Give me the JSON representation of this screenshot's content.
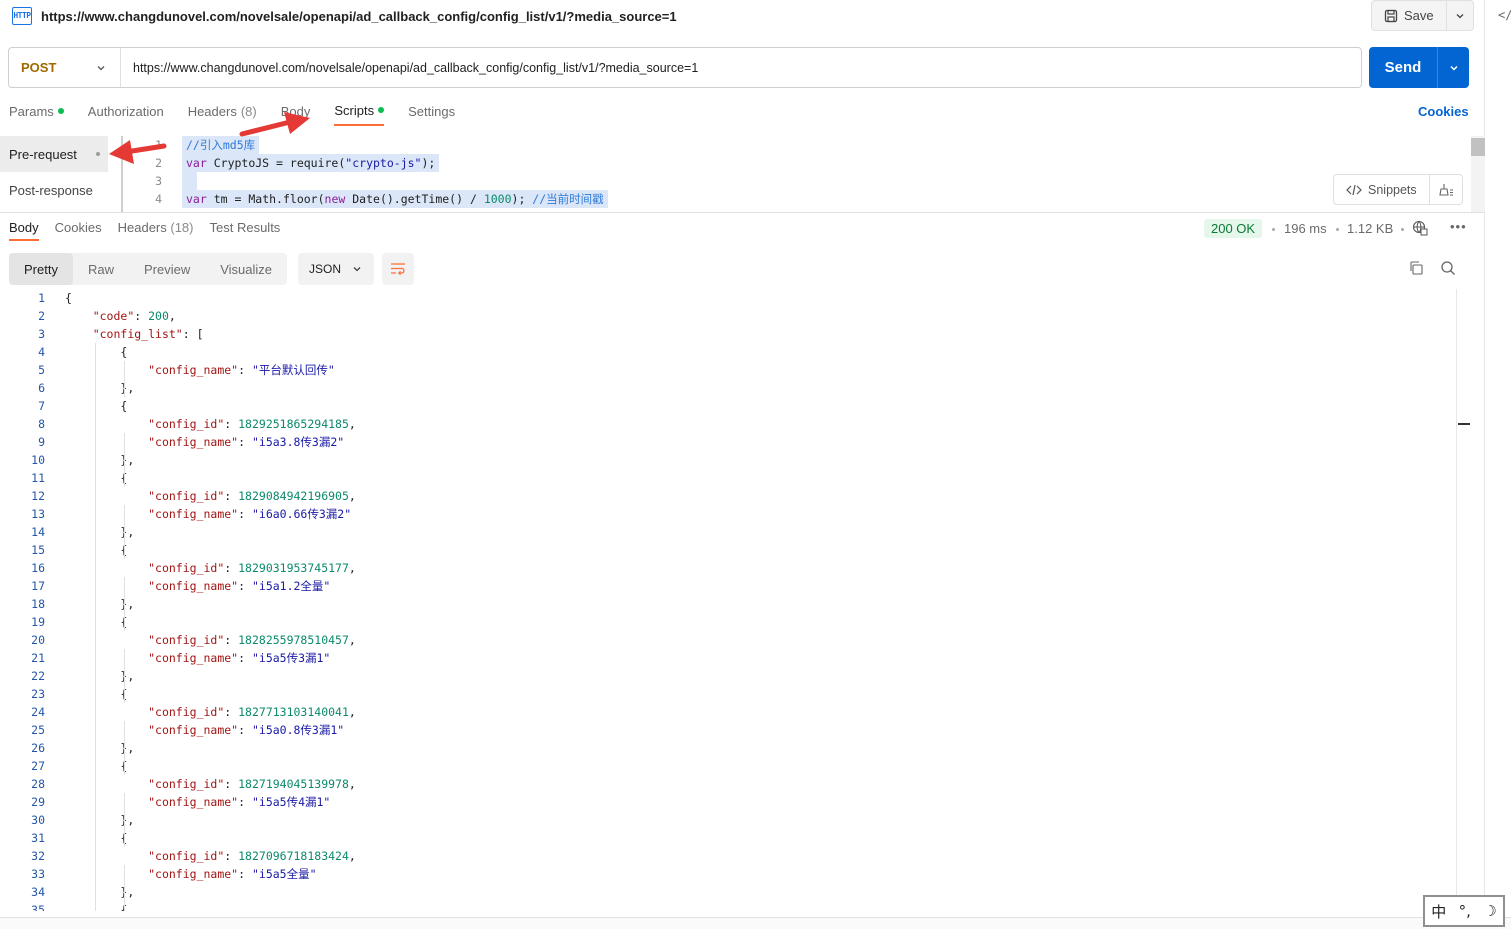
{
  "titlebar": {
    "badge": "HTTP",
    "title": "https://www.changdunovel.com/novelsale/openapi/ad_callback_config/config_list/v1/?media_source=1",
    "save_label": "Save"
  },
  "request": {
    "method": "POST",
    "url": "https://www.changdunovel.com/novelsale/openapi/ad_callback_config/config_list/v1/?media_source=1",
    "send_label": "Send",
    "cookies_label": "Cookies"
  },
  "req_tabs": {
    "params": "Params",
    "authorization": "Authorization",
    "headers": "Headers",
    "headers_count": "(8)",
    "body": "Body",
    "scripts": "Scripts",
    "settings": "Settings"
  },
  "script_side": {
    "pre_request": "Pre-request",
    "post_response": "Post-response"
  },
  "snippets_label": "Snippets",
  "script_lines": [
    {
      "n": "1",
      "comment": "//引入md5库"
    },
    {
      "n": "2",
      "kw": "var",
      "var": "CryptoJS",
      "fn": "require",
      "str": "\"crypto-js\""
    },
    {
      "n": "3"
    },
    {
      "n": "4",
      "kw": "var",
      "var": "tm",
      "expr1": "Math.floor(",
      "kw2": "new",
      "expr2": "Date().getTime()",
      "num": "1000",
      "comment": "//当前时间戳"
    }
  ],
  "res_tabs": {
    "body": "Body",
    "cookies": "Cookies",
    "headers": "Headers",
    "headers_count": "(18)",
    "test_results": "Test Results"
  },
  "response_meta": {
    "status": "200 OK",
    "time": "196 ms",
    "size": "1.12 KB"
  },
  "view_modes": {
    "pretty": "Pretty",
    "raw": "Raw",
    "preview": "Preview",
    "visualize": "Visualize",
    "format": "JSON"
  },
  "json_lines": [
    {
      "n": "1",
      "t": "{"
    },
    {
      "n": "2",
      "k": "\"code\"",
      "v": "200",
      "vt": "num",
      "tail": ",",
      "ind": 1
    },
    {
      "n": "3",
      "k": "\"config_list\"",
      "t2": ": [",
      "ind": 1
    },
    {
      "n": "4",
      "t": "{",
      "ind": 2
    },
    {
      "n": "5",
      "k": "\"config_name\"",
      "v": "\"平台默认回传\"",
      "vt": "str",
      "tail": "",
      "ind": 3
    },
    {
      "n": "6",
      "t": "},",
      "ind": 2
    },
    {
      "n": "7",
      "t": "{",
      "ind": 2
    },
    {
      "n": "8",
      "k": "\"config_id\"",
      "v": "1829251865294185",
      "vt": "num",
      "tail": ",",
      "ind": 3
    },
    {
      "n": "9",
      "k": "\"config_name\"",
      "v": "\"i5a3.8传3漏2\"",
      "vt": "str",
      "tail": "",
      "ind": 3
    },
    {
      "n": "10",
      "t": "},",
      "ind": 2
    },
    {
      "n": "11",
      "t": "{",
      "ind": 2
    },
    {
      "n": "12",
      "k": "\"config_id\"",
      "v": "1829084942196905",
      "vt": "num",
      "tail": ",",
      "ind": 3
    },
    {
      "n": "13",
      "k": "\"config_name\"",
      "v": "\"i6a0.66传3漏2\"",
      "vt": "str",
      "tail": "",
      "ind": 3
    },
    {
      "n": "14",
      "t": "},",
      "ind": 2
    },
    {
      "n": "15",
      "t": "{",
      "ind": 2
    },
    {
      "n": "16",
      "k": "\"config_id\"",
      "v": "1829031953745177",
      "vt": "num",
      "tail": ",",
      "ind": 3
    },
    {
      "n": "17",
      "k": "\"config_name\"",
      "v": "\"i5a1.2全量\"",
      "vt": "str",
      "tail": "",
      "ind": 3
    },
    {
      "n": "18",
      "t": "},",
      "ind": 2
    },
    {
      "n": "19",
      "t": "{",
      "ind": 2
    },
    {
      "n": "20",
      "k": "\"config_id\"",
      "v": "1828255978510457",
      "vt": "num",
      "tail": ",",
      "ind": 3
    },
    {
      "n": "21",
      "k": "\"config_name\"",
      "v": "\"i5a5传3漏1\"",
      "vt": "str",
      "tail": "",
      "ind": 3
    },
    {
      "n": "22",
      "t": "},",
      "ind": 2
    },
    {
      "n": "23",
      "t": "{",
      "ind": 2
    },
    {
      "n": "24",
      "k": "\"config_id\"",
      "v": "1827713103140041",
      "vt": "num",
      "tail": ",",
      "ind": 3
    },
    {
      "n": "25",
      "k": "\"config_name\"",
      "v": "\"i5a0.8传3漏1\"",
      "vt": "str",
      "tail": "",
      "ind": 3
    },
    {
      "n": "26",
      "t": "},",
      "ind": 2
    },
    {
      "n": "27",
      "t": "{",
      "ind": 2
    },
    {
      "n": "28",
      "k": "\"config_id\"",
      "v": "1827194045139978",
      "vt": "num",
      "tail": ",",
      "ind": 3
    },
    {
      "n": "29",
      "k": "\"config_name\"",
      "v": "\"i5a5传4漏1\"",
      "vt": "str",
      "tail": "",
      "ind": 3
    },
    {
      "n": "30",
      "t": "},",
      "ind": 2
    },
    {
      "n": "31",
      "t": "{",
      "ind": 2
    },
    {
      "n": "32",
      "k": "\"config_id\"",
      "v": "1827096718183424",
      "vt": "num",
      "tail": ",",
      "ind": 3
    },
    {
      "n": "33",
      "k": "\"config_name\"",
      "v": "\"i5a5全量\"",
      "vt": "str",
      "tail": "",
      "ind": 3
    },
    {
      "n": "34",
      "t": "},",
      "ind": 2
    },
    {
      "n": "35",
      "t": "{",
      "ind": 2
    }
  ],
  "ime": {
    "lang": "中",
    "punct": "°,",
    "moon": "☽"
  },
  "colors": {
    "accent": "#0265d2",
    "tab_underline": "#ff6c37",
    "status_ok": "#0a7a36",
    "annotation_arrow": "#e53935"
  }
}
